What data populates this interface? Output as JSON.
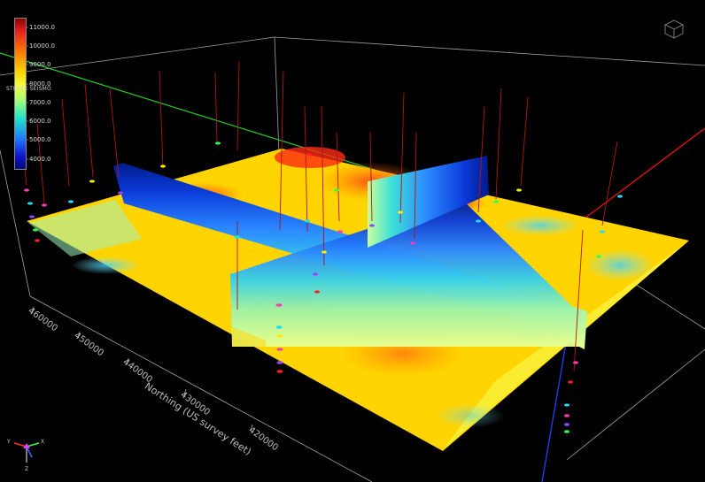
{
  "colorbar": {
    "title": "STEBBE SEISMO",
    "ticks": [
      "11000.0",
      "10000.0",
      "9000.0",
      "8000.0",
      "7000.0",
      "6000.0",
      "5000.0",
      "4000.0"
    ],
    "colors": [
      "#8b0000",
      "#e61e1e",
      "#ff7a00",
      "#ffd200",
      "#f0ff3c",
      "#9cff78",
      "#23e6c8",
      "#1e7bff",
      "#1010c8",
      "#000a78"
    ]
  },
  "northing_axis": {
    "title": "Northing (US survey feet)",
    "labels": [
      "460000",
      "450000",
      "440000",
      "430000",
      "420000"
    ]
  },
  "orientation": {
    "y": "Y",
    "x": "X",
    "z": "Z"
  },
  "scene_colors": {
    "background": "#000000",
    "horizon_main": "#ffd400",
    "section": "#1a4ad0",
    "well_trace": "#b41414",
    "green_line": "#20d020",
    "red_line": "#e01010",
    "blue_line": "#2040ff"
  }
}
